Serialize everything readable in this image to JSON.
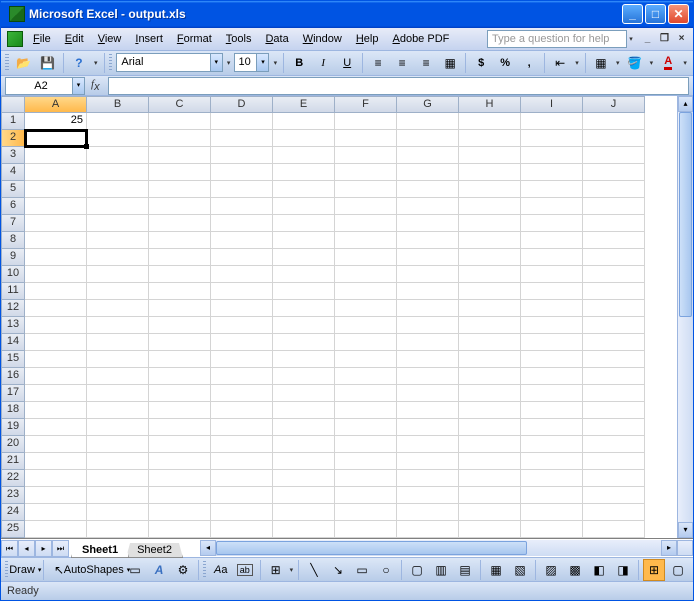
{
  "title": "Microsoft Excel - output.xls",
  "menu": [
    "File",
    "Edit",
    "View",
    "Insert",
    "Format",
    "Tools",
    "Data",
    "Window",
    "Help",
    "Adobe PDF"
  ],
  "help_placeholder": "Type a question for help",
  "font_name": "Arial",
  "font_size": "10",
  "name_box": "A2",
  "formula_value": "",
  "columns": [
    "A",
    "B",
    "C",
    "D",
    "E",
    "F",
    "G",
    "H",
    "I",
    "J"
  ],
  "selected_col": "A",
  "rows": 25,
  "selected_row": 2,
  "active_cell": {
    "row": 2,
    "col": 0
  },
  "cells": {
    "1_0": "25"
  },
  "sheet_tabs": [
    "Sheet1",
    "Sheet2"
  ],
  "active_tab": 0,
  "draw_label": "Draw",
  "autoshapes_label": "AutoShapes",
  "status": "Ready"
}
